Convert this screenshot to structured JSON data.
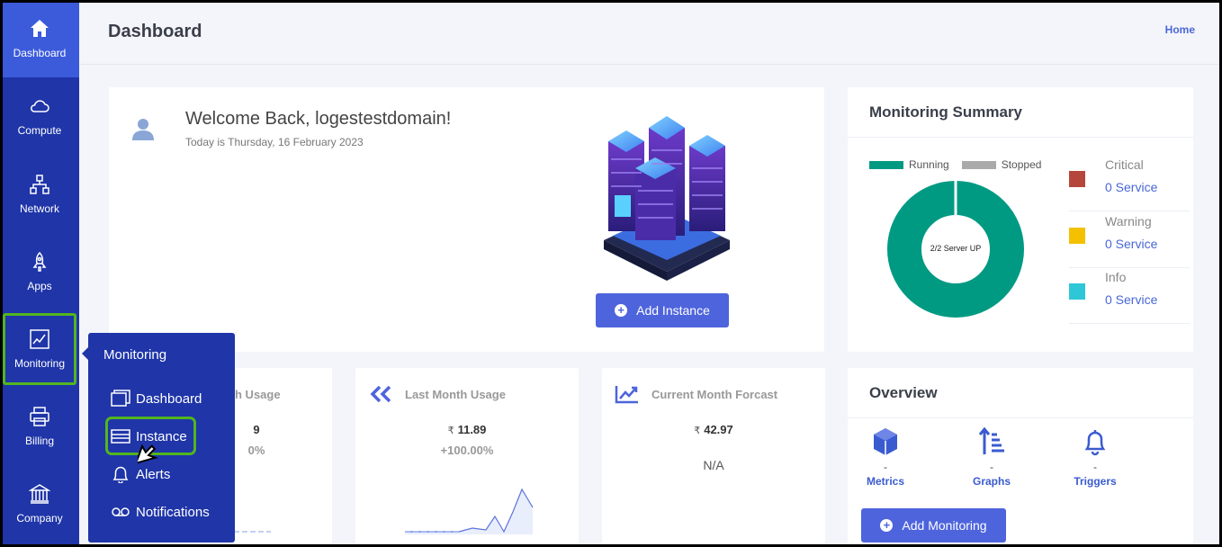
{
  "sidebar": {
    "items": [
      {
        "label": "Dashboard",
        "icon": "home-icon"
      },
      {
        "label": "Compute",
        "icon": "cloud-icon"
      },
      {
        "label": "Network",
        "icon": "network-icon"
      },
      {
        "label": "Apps",
        "icon": "rocket-icon"
      },
      {
        "label": "Monitoring",
        "icon": "chart-icon"
      },
      {
        "label": "Billing",
        "icon": "printer-icon"
      },
      {
        "label": "Company",
        "icon": "bank-icon"
      }
    ]
  },
  "header": {
    "title": "Dashboard",
    "home_link": "Home"
  },
  "welcome": {
    "title": "Welcome Back, logestestdomain!",
    "date": "Today is Thursday, 16 February 2023",
    "add_instance": "Add Instance"
  },
  "summary": {
    "title": "Monitoring Summary",
    "legend_running": "Running",
    "legend_stopped": "Stopped",
    "donut_label": "2/2 Server UP",
    "running_fraction": 1.0,
    "severities": [
      {
        "name": "Critical",
        "value": "0 Service",
        "color": "#b5463c"
      },
      {
        "name": "Warning",
        "value": "0 Service",
        "color": "#f5c000"
      },
      {
        "name": "Info",
        "value": "0 Service",
        "color": "#2ec7d8"
      }
    ]
  },
  "stats": {
    "current": {
      "title": "h Usage",
      "value": "9",
      "pct": "0%"
    },
    "last": {
      "title": "Last Month Usage",
      "currency": "₹",
      "value": "11.89",
      "pct": "+100.00%"
    },
    "forecast": {
      "title": "Current Month Forcast",
      "currency": "₹",
      "value": "42.97",
      "na": "N/A"
    }
  },
  "overview": {
    "title": "Overview",
    "items": [
      {
        "label": "Metrics",
        "value": "-"
      },
      {
        "label": "Graphs",
        "value": "-"
      },
      {
        "label": "Triggers",
        "value": "-"
      }
    ],
    "add_monitoring": "Add Monitoring"
  },
  "flyout": {
    "title": "Monitoring",
    "items": [
      "Dashboard",
      "Instance",
      "Alerts",
      "Notifications"
    ]
  },
  "colors": {
    "sidebar": "#1f35a8",
    "accent": "#4e64dd",
    "running": "#009a83",
    "stopped": "#aaaaaa"
  }
}
